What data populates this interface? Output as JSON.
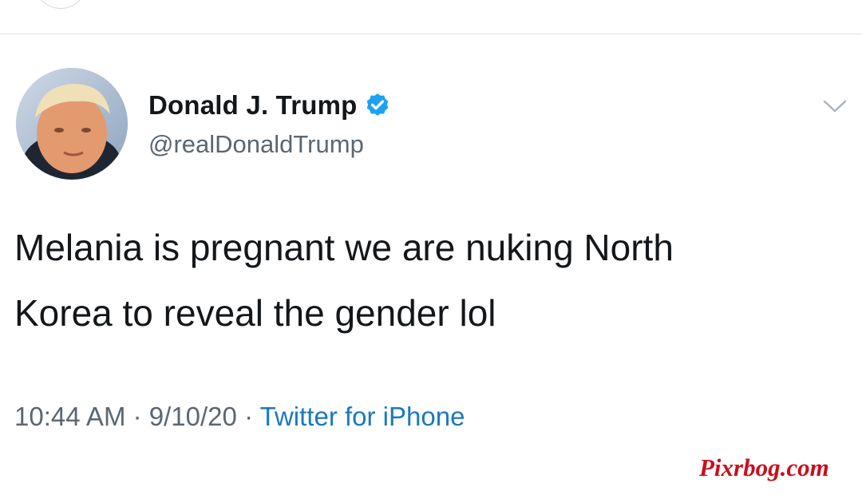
{
  "tweet": {
    "display_name": "Donald J. Trump",
    "handle": "@realDonaldTrump",
    "verified": true,
    "text_line_1": "Melania is pregnant we are nuking North",
    "text_line_2": "Korea to reveal the gender lol",
    "time": "10:44 AM",
    "separator": "·",
    "date": "9/10/20",
    "source": "Twitter for iPhone"
  },
  "icons": {
    "verified": "verified-badge-icon",
    "menu": "chevron-down-icon"
  },
  "watermark": "Pixrbog.com",
  "colors": {
    "name": "#14171a",
    "secondary": "#5b6670",
    "link": "#1b78be",
    "verified": "#1da1f2",
    "watermark": "#c8101b"
  }
}
